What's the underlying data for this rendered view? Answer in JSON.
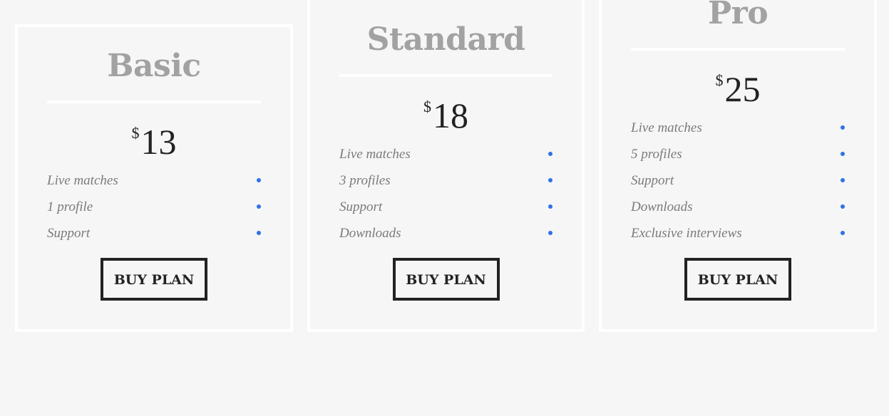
{
  "plans": [
    {
      "name": "Basic",
      "currency": "$",
      "price": "13",
      "features": [
        "Live matches",
        "1 profile",
        "Support"
      ],
      "button_label": "BUY PLAN"
    },
    {
      "name": "Standard",
      "currency": "$",
      "price": "18",
      "features": [
        "Live matches",
        "3 profiles",
        "Support",
        "Downloads"
      ],
      "button_label": "BUY PLAN"
    },
    {
      "name": "Pro",
      "currency": "$",
      "price": "25",
      "features": [
        "Live matches",
        "5 profiles",
        "Support",
        "Downloads",
        "Exclusive interviews"
      ],
      "button_label": "BUY PLAN"
    }
  ],
  "colors": {
    "background": "#f6f6f6",
    "card_border": "#ffffff",
    "plan_name": "#a2a2a2",
    "price": "#222222",
    "feature_text": "#7a7a7a",
    "bullet": "#2f72e6",
    "button_border": "#222222"
  }
}
